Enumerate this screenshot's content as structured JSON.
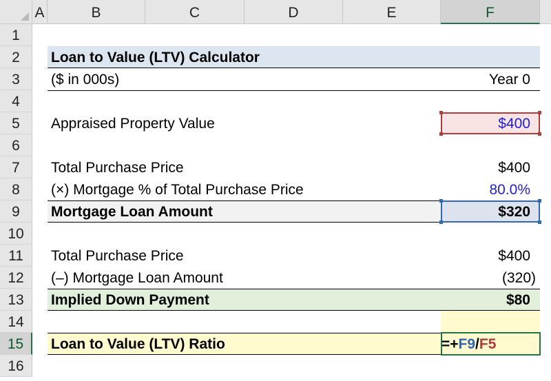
{
  "columns": [
    "A",
    "B",
    "C",
    "D",
    "E",
    "F"
  ],
  "rows": [
    "1",
    "2",
    "3",
    "4",
    "5",
    "6",
    "7",
    "8",
    "9",
    "10",
    "11",
    "12",
    "13",
    "14",
    "15",
    "16"
  ],
  "calculator": {
    "title": "Loan to Value (LTV) Calculator",
    "units": "($ in 000s)",
    "period": "Year 0",
    "appraised_label": "Appraised Property Value",
    "appraised_value": "$400",
    "purchase_price_label": "Total Purchase Price",
    "purchase_price_value": "$400",
    "mortgage_pct_label": "(×) Mortgage % of Total Purchase Price",
    "mortgage_pct_value": "80.0%",
    "mortgage_amount_label": "Mortgage Loan Amount",
    "mortgage_amount_value": "$320",
    "purchase_price_label_2": "Total Purchase Price",
    "purchase_price_value_2": "$400",
    "less_mortgage_label": "(–) Mortgage Loan Amount",
    "less_mortgage_value": "(320)",
    "down_payment_label": "Implied Down Payment",
    "down_payment_value": "$80",
    "ltv_label": "Loan to Value (LTV) Ratio",
    "formula_prefix": "=+",
    "formula_ref1": "F9",
    "formula_op": "/",
    "formula_ref2": "F5"
  },
  "colors": {
    "title_band": "#dce6f1",
    "input_fill": "#f8e4e4",
    "input_border": "#b03c3c",
    "total_fill": "#f2f2f2",
    "ref_box": "#2e68b5",
    "down_payment_fill": "#e2efda",
    "ltv_fill": "#fffbcf",
    "selection": "#217346",
    "ref1_text": "#2e68b5",
    "ref2_text": "#b03c3c"
  }
}
